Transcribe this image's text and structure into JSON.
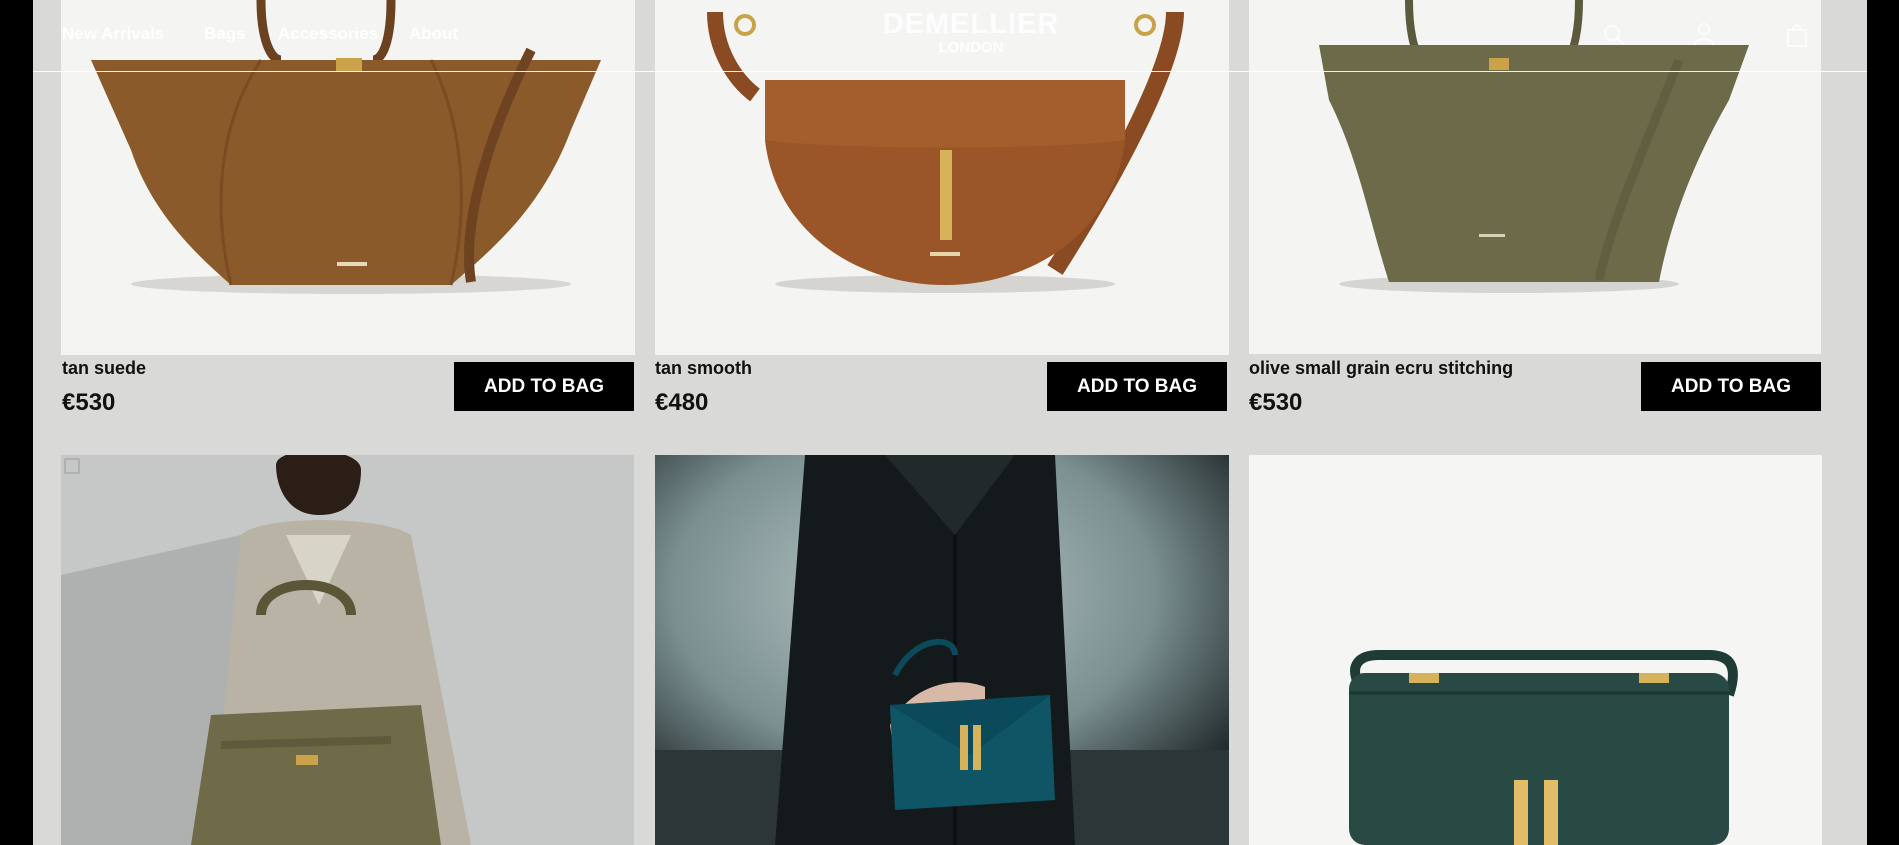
{
  "header": {
    "nav": [
      "New Arrivals",
      "Bags",
      "Accessories",
      "About"
    ],
    "brand": "DEMELLIER",
    "brand_sub": "LONDON",
    "icons": [
      "search-icon",
      "account-icon",
      "bag-icon"
    ]
  },
  "products": [
    {
      "name": "tan suede",
      "price": "€530",
      "button": "ADD TO BAG",
      "image": "tan-suede-tote",
      "color": "#8b5a2b"
    },
    {
      "name": "tan smooth",
      "price": "€480",
      "button": "ADD TO BAG",
      "image": "tan-smooth-saddle-bag",
      "color": "#9a5528"
    },
    {
      "name": "olive small grain ecru stitching",
      "price": "€530",
      "button": "ADD TO BAG",
      "image": "olive-tote",
      "color": "#6d6a4a"
    }
  ],
  "lifestyle": [
    {
      "image": "model-beige-coat-olive-bag"
    },
    {
      "image": "model-black-coat-teal-bag"
    },
    {
      "image": "dark-green-shoulder-bag"
    }
  ]
}
